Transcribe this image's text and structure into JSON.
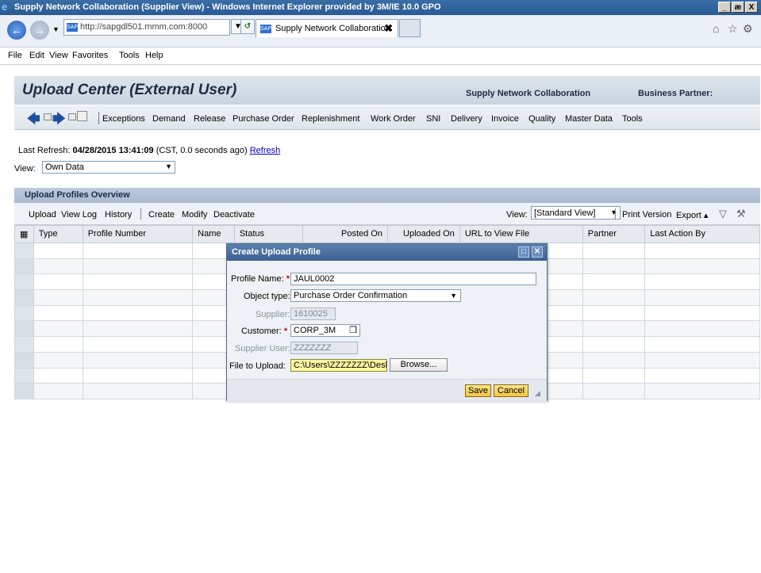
{
  "browser": {
    "title": "Supply Network Collaboration (Supplier View) - Windows Internet Explorer provided by 3M/IE 10.0 GPO",
    "window_buttons": [
      "_",
      "æ",
      "X"
    ],
    "address": "http://sapgdl501.mmm.com:8000",
    "tab_label": "Supply Network Collaboratio...",
    "tab_close": "✖",
    "menu": [
      "File",
      "Edit",
      "View",
      "Favorites",
      "Tools",
      "Help"
    ]
  },
  "app": {
    "title": "Upload Center (External User)",
    "subtitle": "Supply Network Collaboration",
    "business_partner_label": "Business Partner:",
    "nav": [
      "Exceptions",
      "Demand",
      "Release",
      "Purchase Order",
      "Replenishment",
      "Work Order",
      "SNI",
      "Delivery",
      "Invoice",
      "Quality",
      "Master Data",
      "Tools"
    ]
  },
  "status": {
    "last_refresh_label": "Last Refresh:",
    "last_refresh_value": "04/28/2015 13:41:09",
    "last_refresh_note": "(CST, 0.0 seconds ago)",
    "refresh_link": "Refresh"
  },
  "view": {
    "label": "View:",
    "value": "Own Data"
  },
  "panel": {
    "title": "Upload Profiles Overview",
    "toolbar": [
      "Upload",
      "View Log",
      "History",
      "Create",
      "Modify",
      "Deactivate"
    ],
    "view_label": "View:",
    "view_value": "[Standard View]",
    "print_version": "Print Version",
    "export": "Export ▴",
    "columns": [
      "Type",
      "Profile Number",
      "Name",
      "Status",
      "Posted On",
      "Uploaded On",
      "URL to View File",
      "Partner",
      "Last Action By"
    ]
  },
  "dialog": {
    "title": "Create Upload Profile",
    "profile_name_label": "Profile Name:",
    "profile_name_value": "JAUL0002",
    "object_type_label": "Object type:",
    "object_type_value": "Purchase Order Confirmation",
    "supplier_label": "Supplier:",
    "supplier_value": "1610025",
    "customer_label": "Customer:",
    "customer_value": "CORP_3M",
    "supplier_user_label": "Supplier User:",
    "supplier_user_value": "ZZZZZZZ",
    "file_label": "File to Upload:",
    "file_value": "C:\\Users\\ZZZZZZZ\\Deskt",
    "browse": "Browse...",
    "save": "Save",
    "cancel": "Cancel",
    "required_mark": "*"
  },
  "colors": {
    "titlebar": "#2a5a95",
    "dialog_header": "#3d6193",
    "save_button": "#f5c542",
    "required": "#d00000",
    "file_field": "#fff6a0"
  }
}
